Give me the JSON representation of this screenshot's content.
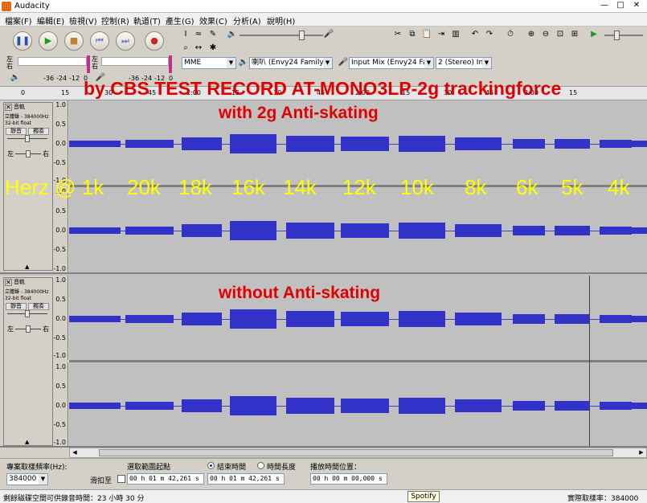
{
  "window": {
    "title": "Audacity",
    "min": "—",
    "max": "□",
    "close": "✕"
  },
  "menu": [
    "檔案(F)",
    "編輯(E)",
    "檢視(V)",
    "控制(R)",
    "軌道(T)",
    "產生(G)",
    "效果(C)",
    "分析(A)",
    "說明(H)"
  ],
  "meters": {
    "left_label": "左\n右",
    "ticks": [
      "-36",
      "-24",
      "-12",
      "0"
    ]
  },
  "device": {
    "host": "MME",
    "output": "喇叭 (Envy24 Family",
    "input": "Input Mix (Envy24 Fa",
    "channels": "2 (Stereo) In"
  },
  "ruler": [
    "0",
    "15",
    "30",
    "45",
    "1:00",
    "15",
    "30",
    "45",
    "2:00",
    "15",
    "30",
    "45",
    "3:00",
    "15"
  ],
  "tracks": [
    {
      "name": "音軌",
      "info": "立體聲 - 384000Hz",
      "fmt": "32-bit float",
      "mute": "靜音",
      "solo": "獨奏",
      "left": "左",
      "right": "右",
      "scale": [
        "1.0",
        "0.5",
        "0.0",
        "-0.5",
        "-1.0"
      ]
    },
    {
      "name": "音軌",
      "info": "立體聲 - 384000Hz",
      "fmt": "32-bit float",
      "mute": "靜音",
      "solo": "獨奏",
      "left": "左",
      "right": "右",
      "scale": [
        "1.0",
        "0.5",
        "0.0",
        "-0.5",
        "-1.0"
      ]
    }
  ],
  "overlay": {
    "title": "by CBS TEST RECORD AT-MONO3LP-2g trackingforce",
    "with": "with 2g Anti-skating",
    "without": "without Anti-skating",
    "freqs": [
      "Herz @ 1k",
      "20k",
      "18k",
      "16k",
      "14k",
      "12k",
      "10k",
      "8k",
      "6k",
      "5k",
      "4k"
    ]
  },
  "selection": {
    "rate_label": "專案取樣頻率(Hz):",
    "rate_value": "384000",
    "snap_label": "滑扣至",
    "start_label": "選取範圍起點",
    "end_label": "結束時間",
    "length_label": "時間長度",
    "pos_label": "播放時間位置：",
    "start_value": "00 h 01 m 42,261 s",
    "end_value": "00 h 01 m 42,261 s",
    "pos_value": "00 h 00 m 00,000 s"
  },
  "status": {
    "left": "剩餘磁碟空間可供錄音時間：23 小時 30 分",
    "tooltip": "Spotify",
    "right": "實際取樣率：384000"
  }
}
